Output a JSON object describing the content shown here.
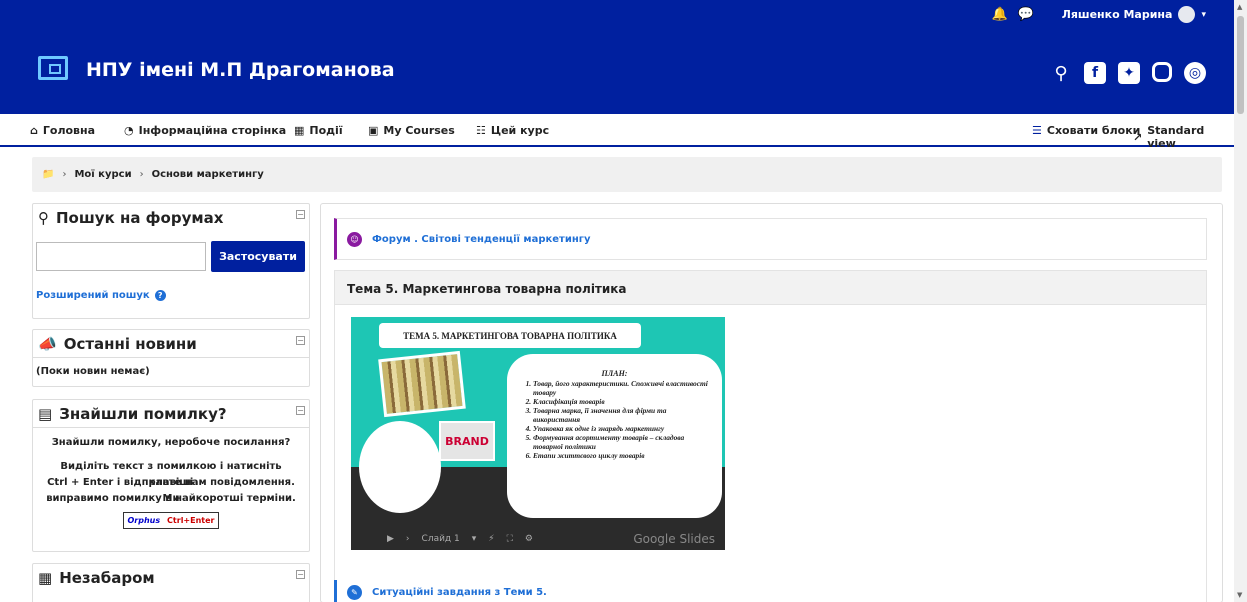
{
  "topbar": {
    "bell_icon": "bell-icon",
    "chat_icon": "chat-icon",
    "user_name": "Ляшенко Марина",
    "caret": "▾"
  },
  "header": {
    "site_title": "НПУ імені М.П Драгоманова",
    "social": [
      "search-icon",
      "facebook-icon",
      "twitter-icon",
      "instagram-icon",
      "globe-icon"
    ]
  },
  "nav": {
    "items": [
      {
        "label": "Головна",
        "icon": "home-icon"
      },
      {
        "label": "Інформаційна сторінка",
        "icon": "tachometer-icon"
      },
      {
        "label": "Події",
        "icon": "calendar-icon"
      },
      {
        "label": "My Courses",
        "icon": "briefcase-icon"
      },
      {
        "label": "Цей курс",
        "icon": "sitemap-icon"
      }
    ],
    "hide_blocks": "Сховати блоки",
    "standard_view": "Standard view"
  },
  "breadcrumb": {
    "items": [
      "Мої курси",
      "Основи маркетингу"
    ]
  },
  "blocks": {
    "forum_search": {
      "title": "Пошук на форумах",
      "input_value": "",
      "apply": "Застосувати",
      "advanced": "Розширений пошук"
    },
    "news": {
      "title": "Останні новини",
      "empty": "(Поки новин немає)"
    },
    "found_error": {
      "title": "Знайшли помилку?",
      "line1": "Знайшли помилку, неробоче посилання?",
      "line2": "Виділіть текст з помилкою і натисніть клавіші",
      "line3": "Ctrl + Enter і відправте нам повідомлення. Ми",
      "line4": "виправимо помилку в найкоротші терміни.",
      "orphus": "Orphus",
      "ctrl_enter": "Ctrl+Enter"
    },
    "upcoming": {
      "title": "Незабаром"
    }
  },
  "main": {
    "forum_link": "Форум . Світові тенденції маркетингу",
    "section_title": "Тема 5. Маркетингова товарна політика",
    "slide": {
      "title": "ТЕМА 5. МАРКЕТИНГОВА ТОВАРНА ПОЛІТИКА",
      "plan_head": "ПЛАН:",
      "plan": [
        "Товар, його характеристики. Споживчі властивості товару",
        "Класифікація товарів",
        "Товарна марка, її значення для фірми та використання",
        "Упаковка як одне із знарядь маркетингу",
        "Формування асортименту товарів – складова товарної політики",
        "Етапи життєвого циклу товарів"
      ],
      "brand": "BRAND",
      "slide_label": "Слайд 1",
      "google_slides": "Google Slides"
    },
    "task_link": "Ситуаційні завдання з Теми 5."
  }
}
